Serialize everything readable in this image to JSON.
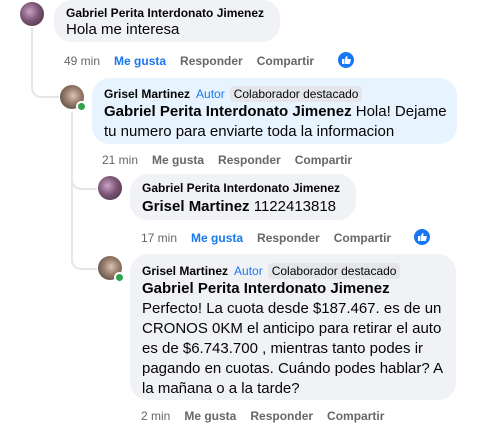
{
  "comments": [
    {
      "name": "Gabriel Perita Interdonato Jimenez",
      "text": "Hola me interesa",
      "time": "49 min",
      "like": "Me gusta",
      "reply": "Responder",
      "share": "Compartir"
    },
    {
      "name": "Grisel Martinez",
      "author": "Autor",
      "badge": "Colaborador destacado",
      "mention": "Gabriel Perita Interdonato Jimenez",
      "text": " Hola! Dejame tu numero para enviarte toda la informacion",
      "time": "21 min",
      "like": "Me gusta",
      "reply": "Responder",
      "share": "Compartir"
    },
    {
      "name": "Gabriel Perita Interdonato Jimenez",
      "mention": "Grisel Martinez",
      "text": " 1122413818",
      "time": "17 min",
      "like": "Me gusta",
      "reply": "Responder",
      "share": "Compartir"
    },
    {
      "name": "Grisel Martinez",
      "author": "Autor",
      "badge": "Colaborador destacado",
      "mention": "Gabriel Perita Interdonato Jimenez",
      "text": " Perfecto! La cuota desde $187.467. es de un CRONOS 0KM el anticipo para retirar el auto es de $6.743.700 , mientras tanto podes ir pagando en cuotas. Cuándo podes hablar? A la mañana o a la tarde?",
      "time": "2 min",
      "like": "Me gusta",
      "reply": "Responder",
      "share": "Compartir"
    }
  ],
  "icons": {
    "like": "thumbs-up-icon"
  },
  "colors": {
    "accent": "#1877f2",
    "bubble": "#f0f2f5",
    "highlight": "#e7f3ff",
    "online": "#31a24c"
  }
}
